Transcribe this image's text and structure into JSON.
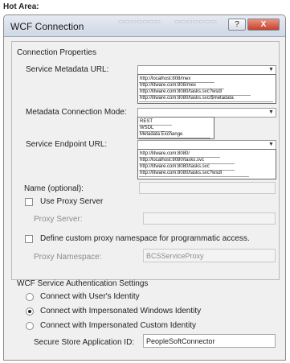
{
  "caption": "Hot Area:",
  "window": {
    "title": "WCF Connection",
    "help_label": "?",
    "close_label": "X"
  },
  "connection": {
    "section_title": "Connection Properties",
    "metadata_url": {
      "label": "Service Metadata URL:",
      "value": "",
      "options": [
        "http://localhost:808/mex",
        "http://litware.com:808/mex",
        "http://litware.com:8080/tasks.svc?wsdl",
        "http://litware.com:8080/tasks.svc/$metadata"
      ]
    },
    "metadata_mode": {
      "label": "Metadata Connection Mode:",
      "value": "",
      "options": [
        "REST",
        "WSDL",
        "Metadata Exchange"
      ]
    },
    "endpoint_url": {
      "label": "Service Endpoint URL:",
      "value": "",
      "options": [
        "http://litware.com:8080/",
        "http://localhost:8080/tasks.svc",
        "http://litware.com:8080/tasks.svc",
        "http://litware.com:8080/tasks.svc?wsdl"
      ]
    },
    "name_label": "Name (optional):",
    "use_proxy_label": "Use Proxy Server",
    "proxy_server_label": "Proxy Server:",
    "custom_ns_label": "Define custom proxy namespace for programmatic access.",
    "proxy_ns_label": "Proxy Namespace:",
    "proxy_ns_value": "BCSServiceProxy"
  },
  "auth": {
    "section_title": "WCF Service Authentication Settings",
    "options": [
      "Connect with User's Identity",
      "Connect with Impersonated Windows Identity",
      "Connect with Impersonated Custom Identity"
    ],
    "selected_index": 1,
    "store_label": "Secure Store Application ID:",
    "store_value": "PeopleSoftConnector"
  }
}
